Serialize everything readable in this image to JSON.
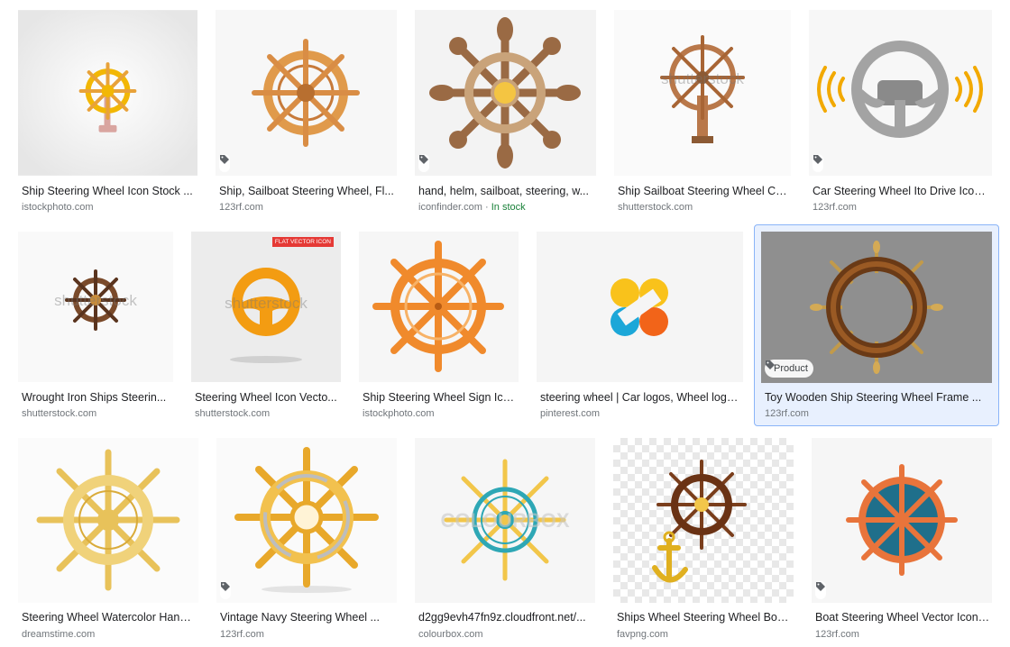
{
  "results": [
    {
      "title": "Ship Steering Wheel Icon Stock ...",
      "source": "istockphoto.com"
    },
    {
      "title": "Ship, Sailboat Steering Wheel, Fl...",
      "source": "123rf.com"
    },
    {
      "title": "hand, helm, sailboat, steering, w...",
      "source": "iconfinder.com",
      "stock": "In stock"
    },
    {
      "title": "Ship Sailboat Steering Wheel Ca...",
      "source": "shutterstock.com",
      "watermark": "shutterstock"
    },
    {
      "title": "Car Steering Wheel Ito Drive Icon ...",
      "source": "123rf.com"
    },
    {
      "title": "Wrought Iron Ships Steerin...",
      "source": "shutterstock.com",
      "watermark": "shutterstock"
    },
    {
      "title": "Steering Wheel Icon Vecto...",
      "source": "shutterstock.com",
      "badge": "FLAT VECTOR ICON",
      "watermark": "shutterstock"
    },
    {
      "title": "Ship Steering Wheel Sign Ico...",
      "source": "istockphoto.com"
    },
    {
      "title": "steering wheel | Car logos, Wheel logo...",
      "source": "pinterest.com"
    },
    {
      "title": "Toy Wooden Ship Steering Wheel Frame ...",
      "source": "123rf.com",
      "tag": "Product"
    },
    {
      "title": "Steering Wheel Watercolor Hand ...",
      "source": "dreamstime.com"
    },
    {
      "title": "Vintage Navy Steering Wheel ...",
      "source": "123rf.com"
    },
    {
      "title": "d2gg9evh47fn9z.cloudfront.net/...",
      "source": "colourbox.com",
      "watermark": "COLOURBOX"
    },
    {
      "title": "Ships Wheel Steering Wheel Boa...",
      "source": "favpng.com"
    },
    {
      "title": "Boat Steering Wheel Vector Icon ...",
      "source": "123rf.com"
    }
  ],
  "icons": {
    "tag": "tag-icon"
  },
  "colors": {
    "selected_border": "#8ab4f8",
    "selected_bg": "#e8f0fe",
    "in_stock": "#188038",
    "source": "#70757a"
  }
}
